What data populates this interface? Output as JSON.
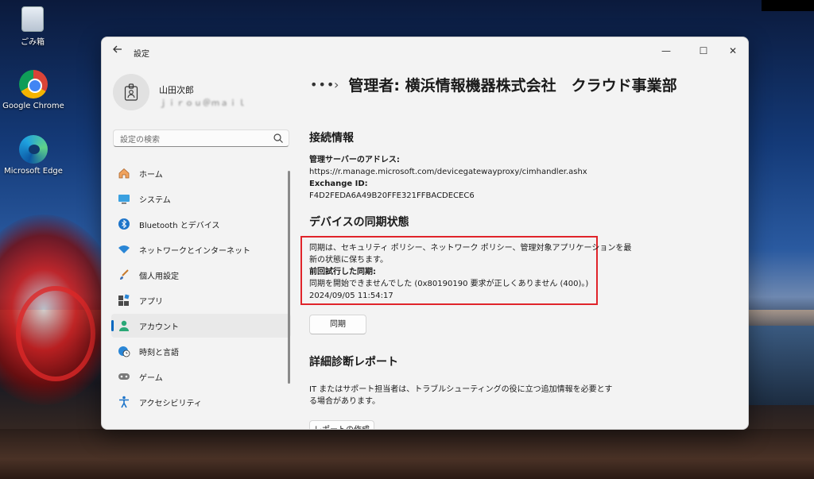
{
  "desktop": {
    "icons": [
      {
        "label": "ごみ箱"
      },
      {
        "label": "Google Chrome"
      },
      {
        "label": "Microsoft Edge"
      }
    ]
  },
  "window": {
    "app_title": "設定",
    "controls": {
      "minimize": "—",
      "maximize": "☐",
      "close": "✕"
    }
  },
  "profile": {
    "name": "山田次郎",
    "email": "ｊｉｒｏｕ＠ｍａｉｌ"
  },
  "search": {
    "placeholder": "設定の検索"
  },
  "nav": {
    "items": [
      {
        "label": "ホーム",
        "icon": "home-icon"
      },
      {
        "label": "システム",
        "icon": "monitor-icon"
      },
      {
        "label": "Bluetooth とデバイス",
        "icon": "bluetooth-icon"
      },
      {
        "label": "ネットワークとインターネット",
        "icon": "wifi-icon"
      },
      {
        "label": "個人用設定",
        "icon": "brush-icon"
      },
      {
        "label": "アプリ",
        "icon": "apps-icon"
      },
      {
        "label": "アカウント",
        "icon": "person-icon",
        "active": true
      },
      {
        "label": "時刻と言語",
        "icon": "globe-clock-icon"
      },
      {
        "label": "ゲーム",
        "icon": "gamepad-icon"
      },
      {
        "label": "アクセシビリティ",
        "icon": "accessibility-icon"
      }
    ]
  },
  "breadcrumb": {
    "dots": "•••",
    "separator": "›",
    "title": "管理者: 横浜情報機器株式会社　クラウド事業部"
  },
  "connection": {
    "heading": "接続情報",
    "server_label": "管理サーバーのアドレス:",
    "server_value": "https://r.manage.microsoft.com/devicegatewayproxy/cimhandler.ashx",
    "exchange_label": "Exchange ID:",
    "exchange_value": "F4D2FEDA6A49B20FFE321FFBACDECEC6"
  },
  "sync": {
    "heading": "デバイスの同期状態",
    "desc_line1": "同期は、セキュリティ ポリシー、ネットワーク ポリシー、管理対象アプリケーションを最",
    "desc_line2": "新の状態に保ちます。",
    "last_label": "前回試行した同期:",
    "last_value": "同期を開始できませんでした (0x80190190 要求が正しくありません (400)。)",
    "timestamp": "2024/09/05 11:54:17",
    "button": "同期"
  },
  "diagnostics": {
    "heading": "詳細診断レポート",
    "desc_line1": "IT またはサポート担当者は、トラブルシューティングの役に立つ追加情報を必要とす",
    "desc_line2": "る場合があります。",
    "button": "レポートの作成"
  },
  "colors": {
    "accent": "#0067c0",
    "highlight_border": "#e0242a",
    "window_bg": "#f3f3f3"
  }
}
